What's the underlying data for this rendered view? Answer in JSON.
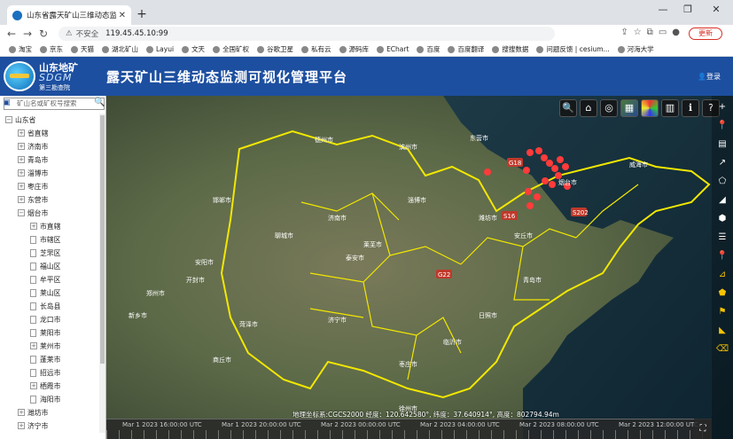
{
  "browser": {
    "tab_title": "山东省露天矿山三维动态监测可视化",
    "new_tab_label": "+",
    "insecure_label": "不安全",
    "url": "119.45.45.10:99",
    "update_label": "更新",
    "bookmarks": [
      "淘宝",
      "京东",
      "天猫",
      "湖北矿山",
      "Layui",
      "文天",
      "全国矿权",
      "谷歌卫星",
      "私有云",
      "源码库",
      "EChart",
      "百度",
      "百度翻译",
      "搜搜数据",
      "问题反馈 | cesium...",
      "河海大学"
    ]
  },
  "header": {
    "logo_name": "山东地矿",
    "logo_en": "SDGM",
    "logo_sub": "第三勘查院",
    "title": "露天矿山三维动态监测可视化管理平台",
    "login": "登录"
  },
  "sidebar": {
    "search_placeholder": "矿山名或矿权号搜索",
    "tree": [
      {
        "label": "山东省",
        "level": 0,
        "icon": "minus"
      },
      {
        "label": "省直辖",
        "level": 1,
        "icon": "plus"
      },
      {
        "label": "济南市",
        "level": 1,
        "icon": "plus"
      },
      {
        "label": "青岛市",
        "level": 1,
        "icon": "plus"
      },
      {
        "label": "淄博市",
        "level": 1,
        "icon": "plus"
      },
      {
        "label": "枣庄市",
        "level": 1,
        "icon": "plus"
      },
      {
        "label": "东营市",
        "level": 1,
        "icon": "plus"
      },
      {
        "label": "烟台市",
        "level": 1,
        "icon": "minus"
      },
      {
        "label": "市直辖",
        "level": 2,
        "icon": "plus"
      },
      {
        "label": "市辖区",
        "level": 2,
        "icon": "doc"
      },
      {
        "label": "芝罘区",
        "level": 2,
        "icon": "doc"
      },
      {
        "label": "福山区",
        "level": 2,
        "icon": "doc"
      },
      {
        "label": "牟平区",
        "level": 2,
        "icon": "doc"
      },
      {
        "label": "莱山区",
        "level": 2,
        "icon": "doc"
      },
      {
        "label": "长岛县",
        "level": 2,
        "icon": "doc"
      },
      {
        "label": "龙口市",
        "level": 2,
        "icon": "doc"
      },
      {
        "label": "莱阳市",
        "level": 2,
        "icon": "doc"
      },
      {
        "label": "莱州市",
        "level": 2,
        "icon": "plus"
      },
      {
        "label": "蓬莱市",
        "level": 2,
        "icon": "doc"
      },
      {
        "label": "招远市",
        "level": 2,
        "icon": "doc"
      },
      {
        "label": "栖霞市",
        "level": 2,
        "icon": "plus"
      },
      {
        "label": "海阳市",
        "level": 2,
        "icon": "doc"
      },
      {
        "label": "潍坊市",
        "level": 1,
        "icon": "plus"
      },
      {
        "label": "济宁市",
        "level": 1,
        "icon": "plus"
      }
    ]
  },
  "map": {
    "coord_readout": "地理坐标系:CGCS2000 经度：120.642580°, 纬度：37.640914°, 高度：802794.94m",
    "timeline_labels": [
      "Mar 1 2023 16:00:00 UTC",
      "Mar 1 2023 20:00:00 UTC",
      "Mar 2 2023 00:00:00 UTC",
      "Mar 2 2023 04:00:00 UTC",
      "Mar 2 2023 08:00:00 UTC",
      "Mar 2 2023 12:00:00 UTC"
    ],
    "top_tools": [
      "search-icon",
      "home-icon",
      "globe-icon",
      "layers-thumbnail",
      "color-wheel-icon",
      "chart-icon",
      "info-icon",
      "help-icon"
    ],
    "right_tools": [
      "zoom-in-icon",
      "location-pin-icon",
      "measure-icon",
      "line-measure-icon",
      "polygon-icon",
      "area-icon",
      "cube-icon",
      "layers-icon",
      "pin-icon",
      "profile-icon",
      "volume-icon",
      "flag-icon",
      "slope-icon",
      "clear-icon"
    ],
    "city_labels": [
      "德州市",
      "滨州市",
      "东营市",
      "济南市",
      "淄博市",
      "潍坊市",
      "烟台市",
      "威海市",
      "青岛市",
      "日照市",
      "临沂市",
      "泰安市",
      "济宁市",
      "菏泽市",
      "枣庄市",
      "聊城市",
      "莱芜市",
      "安阳市",
      "郑州市",
      "开封市",
      "商丘市",
      "徐州市",
      "邯郸市",
      "新乡市",
      "安丘市"
    ],
    "route_labels": [
      "G18",
      "S16",
      "S202",
      "G22"
    ]
  }
}
